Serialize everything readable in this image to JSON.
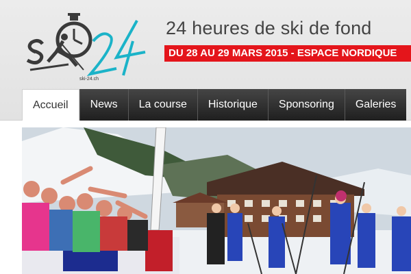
{
  "site": {
    "logo_small_text": "ski-24.ch",
    "title": "24 heures de ski de fond",
    "date_banner": "DU 28 AU 29 MARS 2015 - ESPACE NORDIQUE"
  },
  "nav": {
    "items": [
      {
        "label": "Accueil",
        "active": true
      },
      {
        "label": "News"
      },
      {
        "label": "La course"
      },
      {
        "label": "Historique"
      },
      {
        "label": "Sponsoring"
      },
      {
        "label": "Galeries"
      }
    ]
  },
  "colors": {
    "accent_red": "#e4151b",
    "logo_teal": "#1bb3c8",
    "nav_dark": "#2b2b2b"
  },
  "photo": {
    "icon": "hero-photo"
  }
}
